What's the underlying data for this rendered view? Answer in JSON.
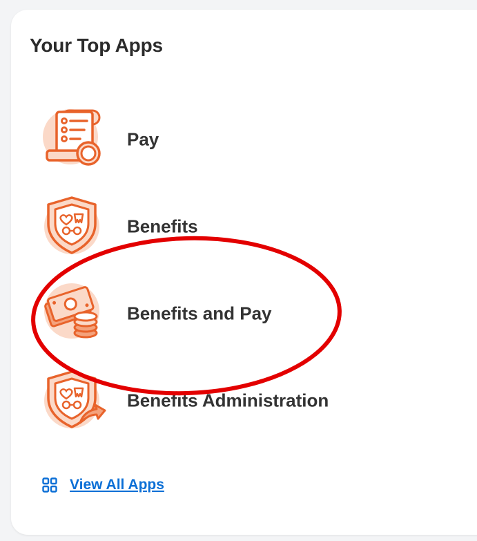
{
  "card": {
    "title": "Your Top Apps"
  },
  "apps": [
    {
      "label": "Pay",
      "icon": "pay-document-coin-icon"
    },
    {
      "label": "Benefits",
      "icon": "benefits-shield-icon"
    },
    {
      "label": "Benefits and Pay",
      "icon": "cash-coins-icon"
    },
    {
      "label": "Benefits Administration",
      "icon": "benefits-admin-shield-arrow-icon"
    }
  ],
  "footer": {
    "view_all_label": "View All Apps",
    "icon": "grid-icon"
  },
  "colors": {
    "icon_orange": "#e8632b",
    "icon_peach": "#fbd9c8",
    "link_blue": "#0b6fd6",
    "annotation_red": "#e30000"
  }
}
